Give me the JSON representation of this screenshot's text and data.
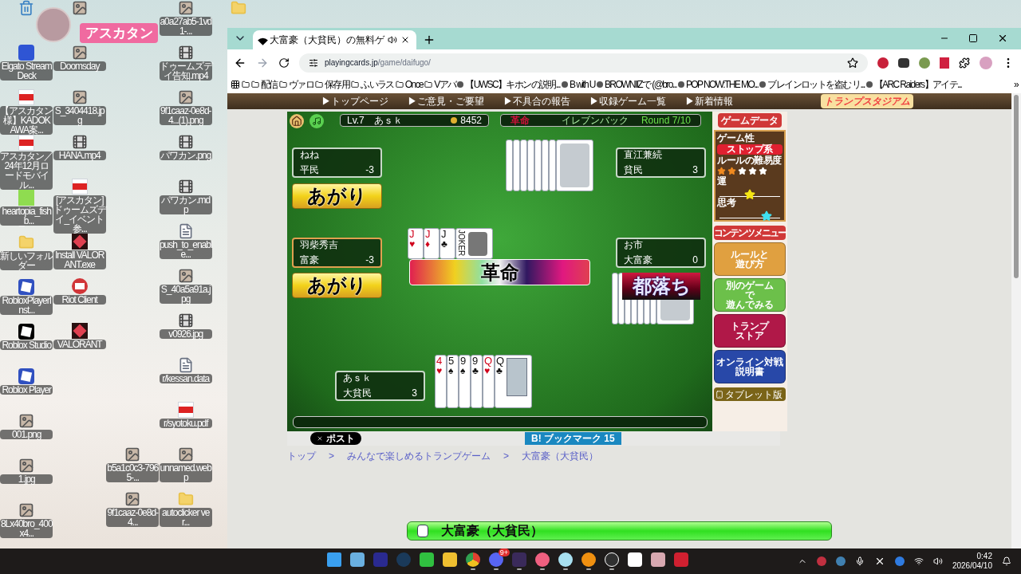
{
  "desktop": {
    "columns": [
      [
        {
          "kind": "recycle"
        },
        {
          "kind": "app",
          "label": "Elgato Stream Deck"
        },
        {
          "kind": "pdf",
          "label": "【アスカタン様】KADOKAWA案..."
        },
        {
          "kind": "pdf",
          "label": "アスカタン／24年12月ロードモバイル..."
        },
        {
          "kind": "green",
          "label": "heartopia_fish_b..."
        },
        {
          "kind": "folder",
          "label": "新しいフォルダー"
        },
        {
          "kind": "roblox",
          "label": "RobloxPlayerInst..."
        },
        {
          "kind": "roblox-dark",
          "label": "Roblox Studio"
        },
        {
          "kind": "roblox",
          "label": "Roblox Player"
        },
        {
          "kind": "image",
          "label": "001.png"
        },
        {
          "kind": "image",
          "label": "1.jpg"
        },
        {
          "kind": "image",
          "label": "8Lx40bro_400x4..."
        }
      ],
      [
        {
          "kind": "image"
        },
        {
          "kind": "image",
          "label": "Doomsday"
        },
        {
          "kind": "image",
          "label": "S_3404418.jpg"
        },
        {
          "kind": "video",
          "label": "HANA.mp4"
        },
        {
          "kind": "pdf",
          "label": "[アスカタン]ドゥームズデイ_イベント参..."
        },
        {
          "kind": "valorant",
          "label": "Install VALORANT.exe"
        },
        {
          "kind": "riot",
          "label": "Riot Client"
        },
        {
          "kind": "valorant",
          "label": "VALORANT"
        },
        {
          "kind": "blank"
        },
        {
          "kind": "blank"
        },
        {
          "kind": "blank"
        },
        {
          "kind": "blank"
        }
      ],
      [
        {
          "kind": "blank"
        },
        {
          "kind": "blank"
        },
        {
          "kind": "blank"
        },
        {
          "kind": "blank"
        },
        {
          "kind": "blank"
        },
        {
          "kind": "blank"
        },
        {
          "kind": "blank"
        },
        {
          "kind": "blank"
        },
        {
          "kind": "blank"
        },
        {
          "kind": "blank"
        },
        {
          "kind": "image",
          "label": "b5a1c0c3-7965-..."
        },
        {
          "kind": "image",
          "label": "9f1caaz-0e8d-4..."
        }
      ],
      [
        {
          "kind": "image",
          "label": "a0a27ab5-1vd1-..."
        },
        {
          "kind": "video",
          "label": "ドゥームズデイ告知.mp4"
        },
        {
          "kind": "image",
          "label": "9f1caaz-0e8d-4...(1).png"
        },
        {
          "kind": "video",
          "label": "パワカン.png"
        },
        {
          "kind": "video",
          "label": "パワカン.mdp"
        },
        {
          "kind": "file",
          "label": "push_to_enable..."
        },
        {
          "kind": "image",
          "label": "S_40a5a91a.jpg"
        },
        {
          "kind": "video",
          "label": "v0926.jpg"
        },
        {
          "kind": "file",
          "label": "r/kessan.data"
        },
        {
          "kind": "pdf",
          "label": "r/syotoku.pdf"
        },
        {
          "kind": "image",
          "label": "unnamed.webp"
        },
        {
          "kind": "folder",
          "label": "autoclicker ver..."
        }
      ],
      [
        {
          "kind": "folder"
        }
      ]
    ],
    "overlay": {
      "name": "アスカタン"
    }
  },
  "browser": {
    "tab": {
      "title": "大富豪（大貧民）の無料ゲ"
    },
    "url": {
      "host": "playingcards.jp",
      "path": "/game/daifugo/"
    },
    "bookmarks": [
      {
        "kind": "folder"
      },
      {
        "kind": "folder",
        "label": "配信"
      },
      {
        "kind": "folder",
        "label": "ヴァロ"
      },
      {
        "kind": "folder",
        "label": "保存用"
      },
      {
        "kind": "folder",
        "label": "ふいラス"
      },
      {
        "kind": "folder",
        "label": "Once"
      },
      {
        "kind": "folder",
        "label": "Vアバ"
      },
      {
        "kind": "site",
        "label": "【UWSC】キホンの説明..."
      },
      {
        "kind": "site",
        "label": "B with U"
      },
      {
        "kind": "site",
        "label": "BROWNIIZで (@bro..."
      },
      {
        "kind": "site",
        "label": "POP NOW:THE MO..."
      },
      {
        "kind": "site",
        "label": "ブレインロットを盗む リ..."
      },
      {
        "kind": "site",
        "label": "【ARC Raiders】アイテ..."
      }
    ],
    "more": "»"
  },
  "site": {
    "nav": [
      "▶トップページ",
      "▶ご意見・ご要望",
      "▶不具合の報告",
      "▶収録ゲーム一覧",
      "▶新着情報"
    ],
    "logo": "トランプスタジアム",
    "game": {
      "status": {
        "level": "Lv.7",
        "player": "あｓｋ",
        "coins": "8452",
        "alert": "革命",
        "rule": "イレブンバック",
        "round": "Round 7/10"
      },
      "players": [
        {
          "name": "ねね",
          "rank": "平民",
          "score": "-3",
          "highlighted": false,
          "badge": {
            "kind": "agari",
            "text": "あがり"
          }
        },
        {
          "name": "直江兼続",
          "rank": "貧民",
          "score": "3",
          "highlighted": false,
          "cards": [
            {
              "kind": "back"
            },
            {
              "kind": "back"
            },
            {
              "kind": "back"
            },
            {
              "kind": "back"
            },
            {
              "kind": "back"
            },
            {
              "kind": "back"
            },
            {
              "kind": "back"
            },
            {
              "kind": "back"
            }
          ]
        },
        {
          "name": "羽柴秀吉",
          "rank": "富豪",
          "score": "-3",
          "highlighted": true,
          "badge": {
            "kind": "agari",
            "text": "あがり"
          }
        },
        {
          "name": "お市",
          "rank": "大富豪",
          "score": "0",
          "highlighted": false,
          "badge": {
            "kind": "fall",
            "text": "都落ち"
          },
          "cards": [
            {
              "kind": "back"
            },
            {
              "kind": "back"
            },
            {
              "kind": "back"
            },
            {
              "kind": "back"
            },
            {
              "kind": "back"
            },
            {
              "kind": "back"
            },
            {
              "kind": "back"
            },
            {
              "kind": "back"
            }
          ]
        },
        {
          "name": "あｓｋ",
          "rank": "大貧民",
          "score": "3",
          "highlighted": false,
          "cards": [
            {
              "kind": "face",
              "rank": "4",
              "suit": "♥",
              "color": "#d0021b"
            },
            {
              "kind": "face",
              "rank": "5",
              "suit": "♠",
              "color": "#111111"
            },
            {
              "kind": "face",
              "rank": "9",
              "suit": "♠",
              "color": "#111111"
            },
            {
              "kind": "face",
              "rank": "9",
              "suit": "♣",
              "color": "#111111"
            },
            {
              "kind": "face",
              "rank": "Q",
              "suit": "♥",
              "color": "#d0021b"
            },
            {
              "kind": "court",
              "rank": "Q",
              "suit": "♣",
              "color": "#111111"
            }
          ]
        }
      ],
      "table": [
        {
          "kind": "face",
          "rank": "J",
          "suit": "♥",
          "color": "#d0021b"
        },
        {
          "kind": "face",
          "rank": "J",
          "suit": "♦",
          "color": "#d0021b"
        },
        {
          "kind": "face",
          "rank": "J",
          "suit": "♣",
          "color": "#111111"
        },
        {
          "kind": "joker",
          "rank": "JOKER",
          "color": "#111111"
        }
      ],
      "banner": "革命"
    },
    "sidebar": {
      "data_title": "ゲームデータ",
      "type_label": "ゲーム性",
      "type_value": "ストップ系",
      "difficulty_label": "ルールの難易度",
      "difficulty": {
        "stars": 2
      },
      "meters": [
        {
          "label": "運",
          "level": 0.5,
          "color": "#f5e614"
        },
        {
          "label": "思考",
          "level": 0.78,
          "color": "#3fe0f0"
        }
      ],
      "menu_title": "コンテンツメニュー",
      "menu": [
        {
          "lines": [
            "ルールと",
            "遊び方"
          ],
          "color": "#e0a040"
        },
        {
          "lines": [
            "別のゲーム",
            "で",
            "遊んでみる"
          ],
          "color": "#6cc04a"
        },
        {
          "lines": [
            "トランプ",
            "ストア"
          ],
          "color": "#b01848"
        },
        {
          "lines": [
            "オンライン対戦",
            "説明書"
          ],
          "color": "#2848a8"
        }
      ],
      "tablet": "タブレット版"
    },
    "share": {
      "post": "ポスト",
      "bookmark": "B! ブックマーク 15"
    },
    "breadcrumb": [
      "トップ",
      "みんなで楽しめるトランプゲーム",
      "大富豪（大貧民）"
    ],
    "breadcrumb_sep": ">",
    "footer_banner": "大富豪（大貧民）"
  },
  "taskbar": {
    "apps": [
      {
        "kind": "start",
        "running": false
      },
      {
        "kind": "widgets",
        "running": false
      },
      {
        "kind": "screen",
        "running": false
      },
      {
        "kind": "steam",
        "running": false
      },
      {
        "kind": "line",
        "running": false
      },
      {
        "kind": "explorer",
        "running": false
      },
      {
        "kind": "chrome",
        "running": true
      },
      {
        "kind": "discord",
        "running": true,
        "badge": "9+"
      },
      {
        "kind": "star",
        "running": true
      },
      {
        "kind": "lips",
        "running": true
      },
      {
        "kind": "smiley",
        "running": true
      },
      {
        "kind": "orange",
        "running": true
      },
      {
        "kind": "obs",
        "running": true
      },
      {
        "kind": "cat",
        "running": false
      },
      {
        "kind": "picture",
        "running": false
      },
      {
        "kind": "red",
        "running": false
      }
    ],
    "time": "0:42",
    "date": "2026/04/10"
  }
}
